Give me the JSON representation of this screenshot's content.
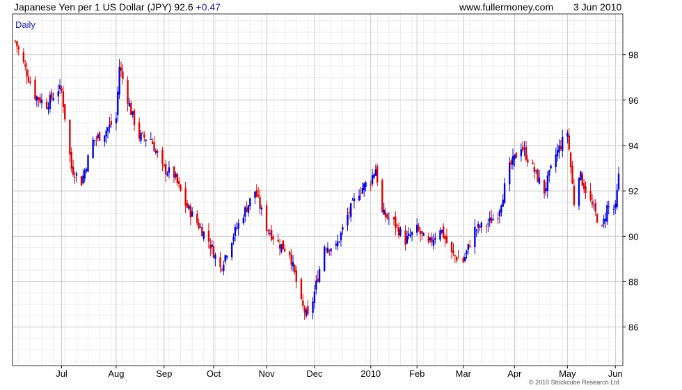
{
  "header": {
    "title": "Japanese Yen per 1 US Dollar (JPY)",
    "last": "92.6",
    "change": "+0.47",
    "site": "www.fullermoney.com",
    "date": "3 Jun 2010"
  },
  "footer": {
    "copyright": "© 2010 Stockcube Research Ltd"
  },
  "colors": {
    "up": "#0000e0",
    "down": "#e00000",
    "grid": "#c8c8c8",
    "minor_grid": "#ececec",
    "period_label": "#1a1aa6"
  },
  "chart_data": {
    "type": "candlestick",
    "period": "Daily",
    "ylim": [
      84.3,
      99.8
    ],
    "yticks": [
      86,
      88,
      90,
      92,
      94,
      96,
      98
    ],
    "x_start": "2009-06-03",
    "x_end": "2010-06-03",
    "month_ticks": [
      {
        "label": "Jul",
        "date": "2009-07-01"
      },
      {
        "label": "Aug",
        "date": "2009-08-03"
      },
      {
        "label": "Sep",
        "date": "2009-09-01"
      },
      {
        "label": "Oct",
        "date": "2009-10-01"
      },
      {
        "label": "Nov",
        "date": "2009-11-02"
      },
      {
        "label": "Dec",
        "date": "2009-12-01"
      },
      {
        "label": "2010",
        "date": "2010-01-04"
      },
      {
        "label": "Feb",
        "date": "2010-02-01"
      },
      {
        "label": "Mar",
        "date": "2010-03-01"
      },
      {
        "label": "Apr",
        "date": "2010-04-01"
      },
      {
        "label": "May",
        "date": "2010-05-03"
      },
      {
        "label": "Jun",
        "date": "2010-06-01"
      }
    ],
    "close_path": [
      [
        "2009-06-03",
        98.6
      ],
      [
        "2009-06-08",
        97.6
      ],
      [
        "2009-06-15",
        96.2
      ],
      [
        "2009-06-22",
        95.8
      ],
      [
        "2009-06-29",
        96.5
      ],
      [
        "2009-07-01",
        96.4
      ],
      [
        "2009-07-07",
        93.0
      ],
      [
        "2009-07-13",
        92.4
      ],
      [
        "2009-07-20",
        94.2
      ],
      [
        "2009-07-27",
        94.6
      ],
      [
        "2009-08-03",
        95.2
      ],
      [
        "2009-08-05",
        97.5
      ],
      [
        "2009-08-12",
        95.5
      ],
      [
        "2009-08-17",
        94.4
      ],
      [
        "2009-08-24",
        94.3
      ],
      [
        "2009-08-31",
        93.0
      ],
      [
        "2009-09-07",
        92.7
      ],
      [
        "2009-09-14",
        91.4
      ],
      [
        "2009-09-21",
        90.6
      ],
      [
        "2009-09-28",
        89.8
      ],
      [
        "2009-10-05",
        88.6
      ],
      [
        "2009-10-12",
        89.9
      ],
      [
        "2009-10-19",
        91.0
      ],
      [
        "2009-10-26",
        92.0
      ],
      [
        "2009-11-02",
        90.4
      ],
      [
        "2009-11-09",
        89.7
      ],
      [
        "2009-11-16",
        89.3
      ],
      [
        "2009-11-23",
        87.0
      ],
      [
        "2009-11-27",
        86.4
      ],
      [
        "2009-11-30",
        87.2
      ],
      [
        "2009-12-07",
        89.6
      ],
      [
        "2009-12-14",
        89.5
      ],
      [
        "2009-12-21",
        90.9
      ],
      [
        "2009-12-28",
        92.0
      ],
      [
        "2010-01-04",
        92.5
      ],
      [
        "2010-01-07",
        93.0
      ],
      [
        "2010-01-11",
        91.0
      ],
      [
        "2010-01-18",
        90.6
      ],
      [
        "2010-01-25",
        89.8
      ],
      [
        "2010-02-01",
        90.3
      ],
      [
        "2010-02-08",
        89.6
      ],
      [
        "2010-02-15",
        90.4
      ],
      [
        "2010-02-22",
        89.2
      ],
      [
        "2010-03-01",
        88.9
      ],
      [
        "2010-03-08",
        90.3
      ],
      [
        "2010-03-15",
        90.5
      ],
      [
        "2010-03-22",
        91.0
      ],
      [
        "2010-03-29",
        93.0
      ],
      [
        "2010-04-05",
        94.0
      ],
      [
        "2010-04-12",
        93.0
      ],
      [
        "2010-04-19",
        92.0
      ],
      [
        "2010-04-26",
        93.6
      ],
      [
        "2010-05-03",
        94.6
      ],
      [
        "2010-05-07",
        91.5
      ],
      [
        "2010-05-10",
        92.8
      ],
      [
        "2010-05-17",
        91.5
      ],
      [
        "2010-05-24",
        90.3
      ],
      [
        "2010-05-27",
        91.3
      ],
      [
        "2010-06-01",
        91.2
      ],
      [
        "2010-06-03",
        92.6
      ]
    ]
  }
}
